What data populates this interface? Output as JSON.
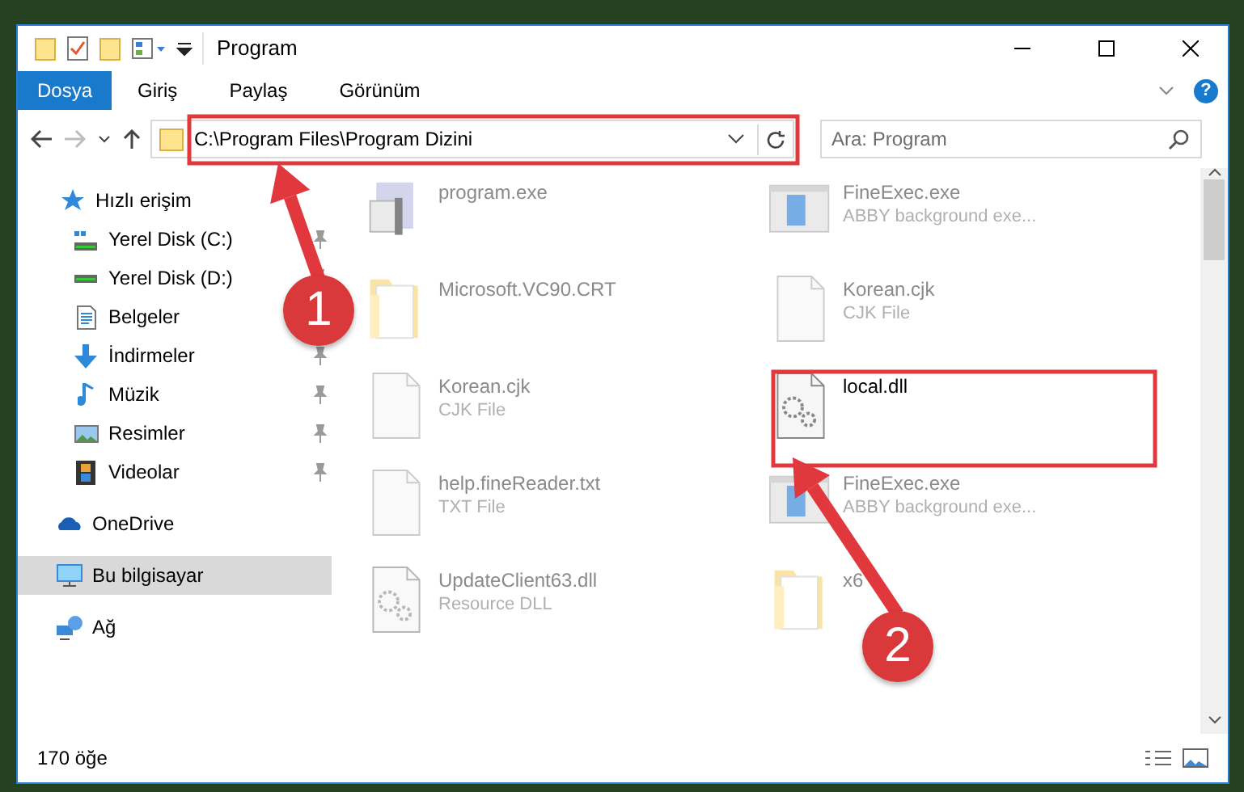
{
  "window": {
    "title": "Program"
  },
  "ribbon": {
    "tabs": [
      {
        "label": "Dosya",
        "selected": true
      },
      {
        "label": "Giriş",
        "selected": false
      },
      {
        "label": "Paylaş",
        "selected": false
      },
      {
        "label": "Görünüm",
        "selected": false
      }
    ],
    "help": "?"
  },
  "address_bar": {
    "path": "C:\\Program Files\\Program Dizini",
    "forward_disabled": true
  },
  "search": {
    "placeholder": "Ara: Program"
  },
  "sidebar": {
    "items": [
      {
        "label": "Hızlı erişim",
        "kind": "star",
        "selected": false,
        "children": [
          {
            "label": "Yerel Disk (C:)",
            "kind": "drive-c",
            "pinned": true,
            "selected": false
          },
          {
            "label": "Yerel Disk (D:)",
            "kind": "drive",
            "pinned": true,
            "selected": false
          },
          {
            "label": "Belgeler",
            "kind": "docs",
            "selected": false
          },
          {
            "label": "İndirmeler",
            "kind": "download",
            "pinned": true,
            "selected": false
          },
          {
            "label": "Müzik",
            "kind": "music",
            "pinned": true,
            "selected": false
          },
          {
            "label": "Resimler",
            "kind": "pictures",
            "pinned": true,
            "selected": false
          },
          {
            "label": "Videolar",
            "kind": "videos",
            "pinned": true,
            "selected": false
          }
        ]
      },
      {
        "label": "OneDrive",
        "kind": "cloud",
        "selected": false
      },
      {
        "label": "Bu bilgisayar",
        "kind": "pc",
        "selected": true
      },
      {
        "label": "Ağ",
        "kind": "network",
        "selected": false
      }
    ]
  },
  "files": [
    {
      "name": "program.exe",
      "kind": "app",
      "blurred": true
    },
    {
      "name": "FineExec.exe",
      "type": "ABBY background exe...",
      "kind": "exe",
      "blurred": true
    },
    {
      "name": "Microsoft.VC90.CRT",
      "kind": "folder",
      "blurred": true
    },
    {
      "name": "Korean.cjk",
      "type": "CJK File",
      "kind": "file",
      "blurred": true
    },
    {
      "name": "Korean.cjk",
      "type": "CJK File",
      "kind": "file",
      "blurred": true
    },
    {
      "name": "local.dll",
      "kind": "dll",
      "blurred": false
    },
    {
      "name": "help.fineReader.txt",
      "type": "TXT File",
      "kind": "file",
      "blurred": true
    },
    {
      "name": "FineExec.exe",
      "type": "ABBY background exe...",
      "kind": "exe",
      "blurred": true
    },
    {
      "name": "UpdateClient63.dll",
      "type": "Resource DLL",
      "kind": "dll",
      "blurred": true
    },
    {
      "name": "x6",
      "kind": "folder",
      "blurred": true
    }
  ],
  "status_bar": {
    "count": "170 öğe"
  },
  "callouts": [
    {
      "label": "1"
    },
    {
      "label": "2"
    }
  ]
}
